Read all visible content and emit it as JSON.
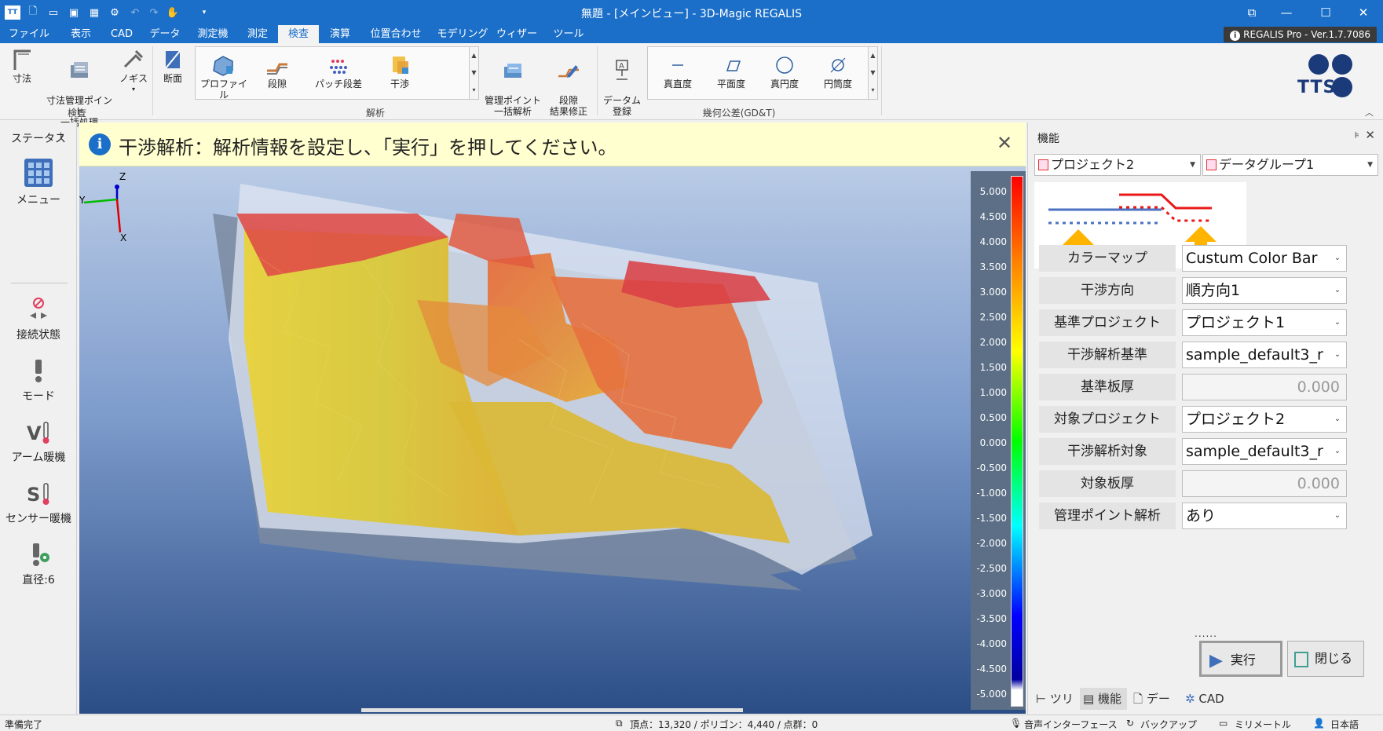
{
  "window": {
    "title": "無題 - [メインビュー] - 3D-Magic REGALIS",
    "controls": {
      "restore": "⧉",
      "minimize": "—",
      "maximize": "☐",
      "close": "✕"
    }
  },
  "menu": {
    "tabs": [
      "ファイル",
      "表示",
      "CAD",
      "データ",
      "測定機",
      "測定",
      "検査",
      "演算",
      "位置合わせ",
      "モデリング",
      "ウィザード",
      "ツール"
    ],
    "active": "検査",
    "version": "REGALIS Pro - Ver.1.7.7086"
  },
  "ribbon": {
    "inspection": {
      "items": [
        {
          "label": "寸法",
          "icon": "dimension-icon"
        },
        {
          "label": "寸法管理ポイント\n一括処理",
          "icon": "batch-points-icon"
        },
        {
          "label": "ノギス",
          "icon": "caliper-icon"
        }
      ],
      "group_label": "検査"
    },
    "analysis": {
      "section": {
        "label": "断面",
        "icon": "section-icon"
      },
      "gallery": [
        {
          "label": "プロファイル",
          "icon": "profile-icon"
        },
        {
          "label": "段隙",
          "icon": "gap-step-icon"
        },
        {
          "label": "パッチ段差",
          "icon": "patch-step-icon"
        },
        {
          "label": "干渉",
          "icon": "interference-icon"
        }
      ],
      "extra": [
        {
          "label": "管理ポイント\n一括解析",
          "icon": "batch-analysis-icon"
        },
        {
          "label": "段隙\n結果修正",
          "icon": "result-edit-icon"
        }
      ],
      "group_label": "解析"
    },
    "gdt": {
      "datum": {
        "label": "データム\n登録",
        "icon": "datum-icon"
      },
      "gallery": [
        {
          "label": "真直度",
          "icon": "straightness-icon"
        },
        {
          "label": "平面度",
          "icon": "flatness-icon"
        },
        {
          "label": "真円度",
          "icon": "roundness-icon"
        },
        {
          "label": "円筒度",
          "icon": "cylindricity-icon"
        }
      ],
      "group_label": "幾何公差(GD&T)"
    },
    "logo": "TTS"
  },
  "status_panel": {
    "title": "ステータス",
    "items": [
      {
        "label": "メニュー",
        "icon": "menu-grid-icon"
      },
      {
        "label": "接続状態",
        "icon": "connection-icon"
      },
      {
        "label": "モード",
        "icon": "probe-mode-icon"
      },
      {
        "label": "アーム暖機",
        "icon": "arm-warmup-icon"
      },
      {
        "label": "センサー暖機",
        "icon": "sensor-warmup-icon"
      },
      {
        "label": "直径:6",
        "icon": "probe-diameter-icon"
      }
    ]
  },
  "info_bar": {
    "text": "干渉解析：解析情報を設定し、「実行」を押してください。",
    "icon": "info-icon"
  },
  "viewport": {
    "axes": {
      "z": "Z",
      "y": "Y",
      "x": "X"
    }
  },
  "color_bar": {
    "ticks": [
      "5.000",
      "4.500",
      "4.000",
      "3.500",
      "3.000",
      "2.500",
      "2.000",
      "1.500",
      "1.000",
      "0.500",
      "0.000",
      "-0.500",
      "-1.000",
      "-1.500",
      "-2.000",
      "-2.500",
      "-3.000",
      "-3.500",
      "-4.000",
      "-4.500",
      "-5.000"
    ]
  },
  "function_panel": {
    "title": "機能",
    "project_combo": "プロジェクト2",
    "group_combo": "データグループ1",
    "rows": [
      {
        "label": "カラーマップ",
        "value": "Custum Color Bar",
        "type": "select"
      },
      {
        "label": "干渉方向",
        "value": "順方向1",
        "type": "select"
      },
      {
        "label": "基準プロジェクト",
        "value": "プロジェクト1",
        "type": "select"
      },
      {
        "label": "干渉解析基準",
        "value": "sample_default3_r",
        "type": "select"
      },
      {
        "label": "基準板厚",
        "value": "0.000",
        "type": "disabled"
      },
      {
        "label": "対象プロジェクト",
        "value": "プロジェクト2",
        "type": "select"
      },
      {
        "label": "干渉解析対象",
        "value": "sample_default3_r",
        "type": "select"
      },
      {
        "label": "対象板厚",
        "value": "0.000",
        "type": "disabled"
      },
      {
        "label": "管理ポイント解析",
        "value": "あり",
        "type": "select"
      }
    ],
    "dots": "......",
    "run_label": "実行",
    "close_label": "閉じる",
    "tabs": [
      {
        "label": "ツリー",
        "icon": "tree-icon"
      },
      {
        "label": "機能",
        "icon": "function-icon"
      },
      {
        "label": "データ",
        "icon": "data-icon"
      },
      {
        "label": "CAD",
        "icon": "cad-icon"
      }
    ],
    "active_tab": "機能"
  },
  "status_bar": {
    "ready": "準備完了",
    "counts": "頂点：13,320 / ポリゴン：4,440 / 点群：0",
    "voice": "音声インターフェース",
    "backup": "バックアップ",
    "unit": "ミリメートル",
    "language": "日本語"
  },
  "colors": {
    "accent": "#1b6fc8",
    "infobar": "#ffffcf",
    "viewport_top": "#b9cbe6",
    "viewport_bottom": "#2b4d86"
  }
}
